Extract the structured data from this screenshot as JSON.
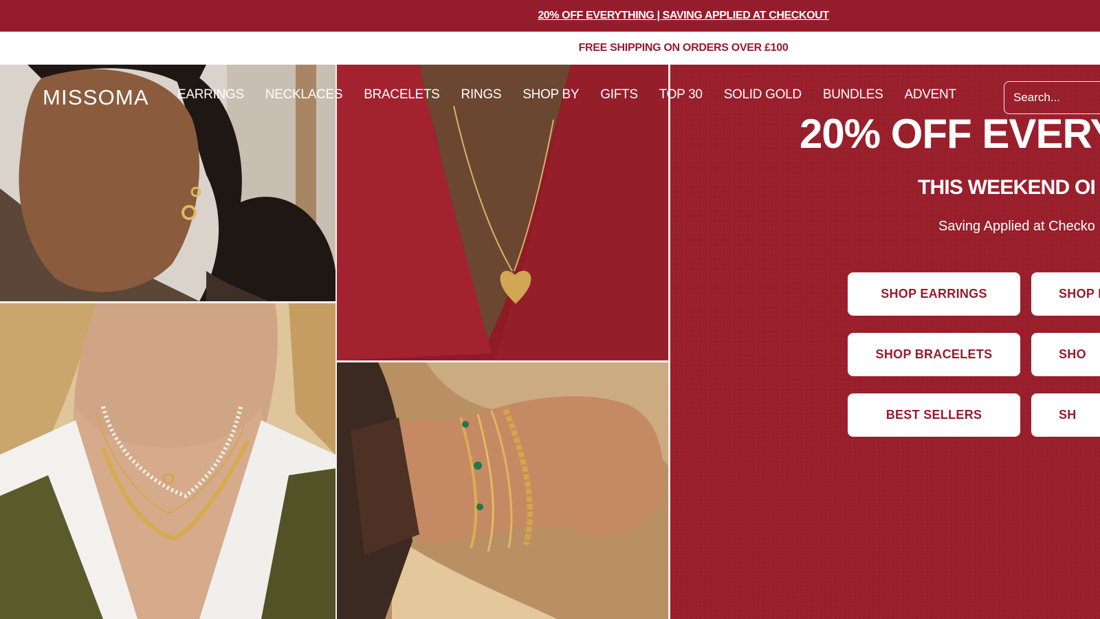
{
  "promo_bar": {
    "text": "20% OFF EVERYTHING | SAVING APPLIED AT CHECKOUT"
  },
  "shipping_bar": {
    "text": "FREE SHIPPING ON ORDERS OVER £100"
  },
  "header": {
    "logo": "MISSOMA",
    "nav": [
      {
        "label": "EARRINGS"
      },
      {
        "label": "NECKLACES"
      },
      {
        "label": "BRACELETS"
      },
      {
        "label": "RINGS"
      },
      {
        "label": "SHOP BY"
      },
      {
        "label": "GIFTS"
      },
      {
        "label": "TOP 30"
      },
      {
        "label": "SOLID GOLD"
      },
      {
        "label": "BUNDLES"
      },
      {
        "label": "ADVENT"
      }
    ],
    "search": {
      "placeholder": "Search..."
    }
  },
  "hero": {
    "title": "20% OFF EVERY",
    "subtitle": "THIS WEEKEND OI",
    "note": "Saving Applied at Checko",
    "buttons": [
      {
        "label": "SHOP EARRINGS"
      },
      {
        "label": "SHOP I"
      },
      {
        "label": "SHOP BRACELETS"
      },
      {
        "label": "SHO"
      },
      {
        "label": "BEST SELLERS"
      },
      {
        "label": "SH"
      }
    ]
  },
  "colors": {
    "brand_red": "#951c2c",
    "panel_red": "#9a1f2c",
    "white": "#ffffff"
  }
}
